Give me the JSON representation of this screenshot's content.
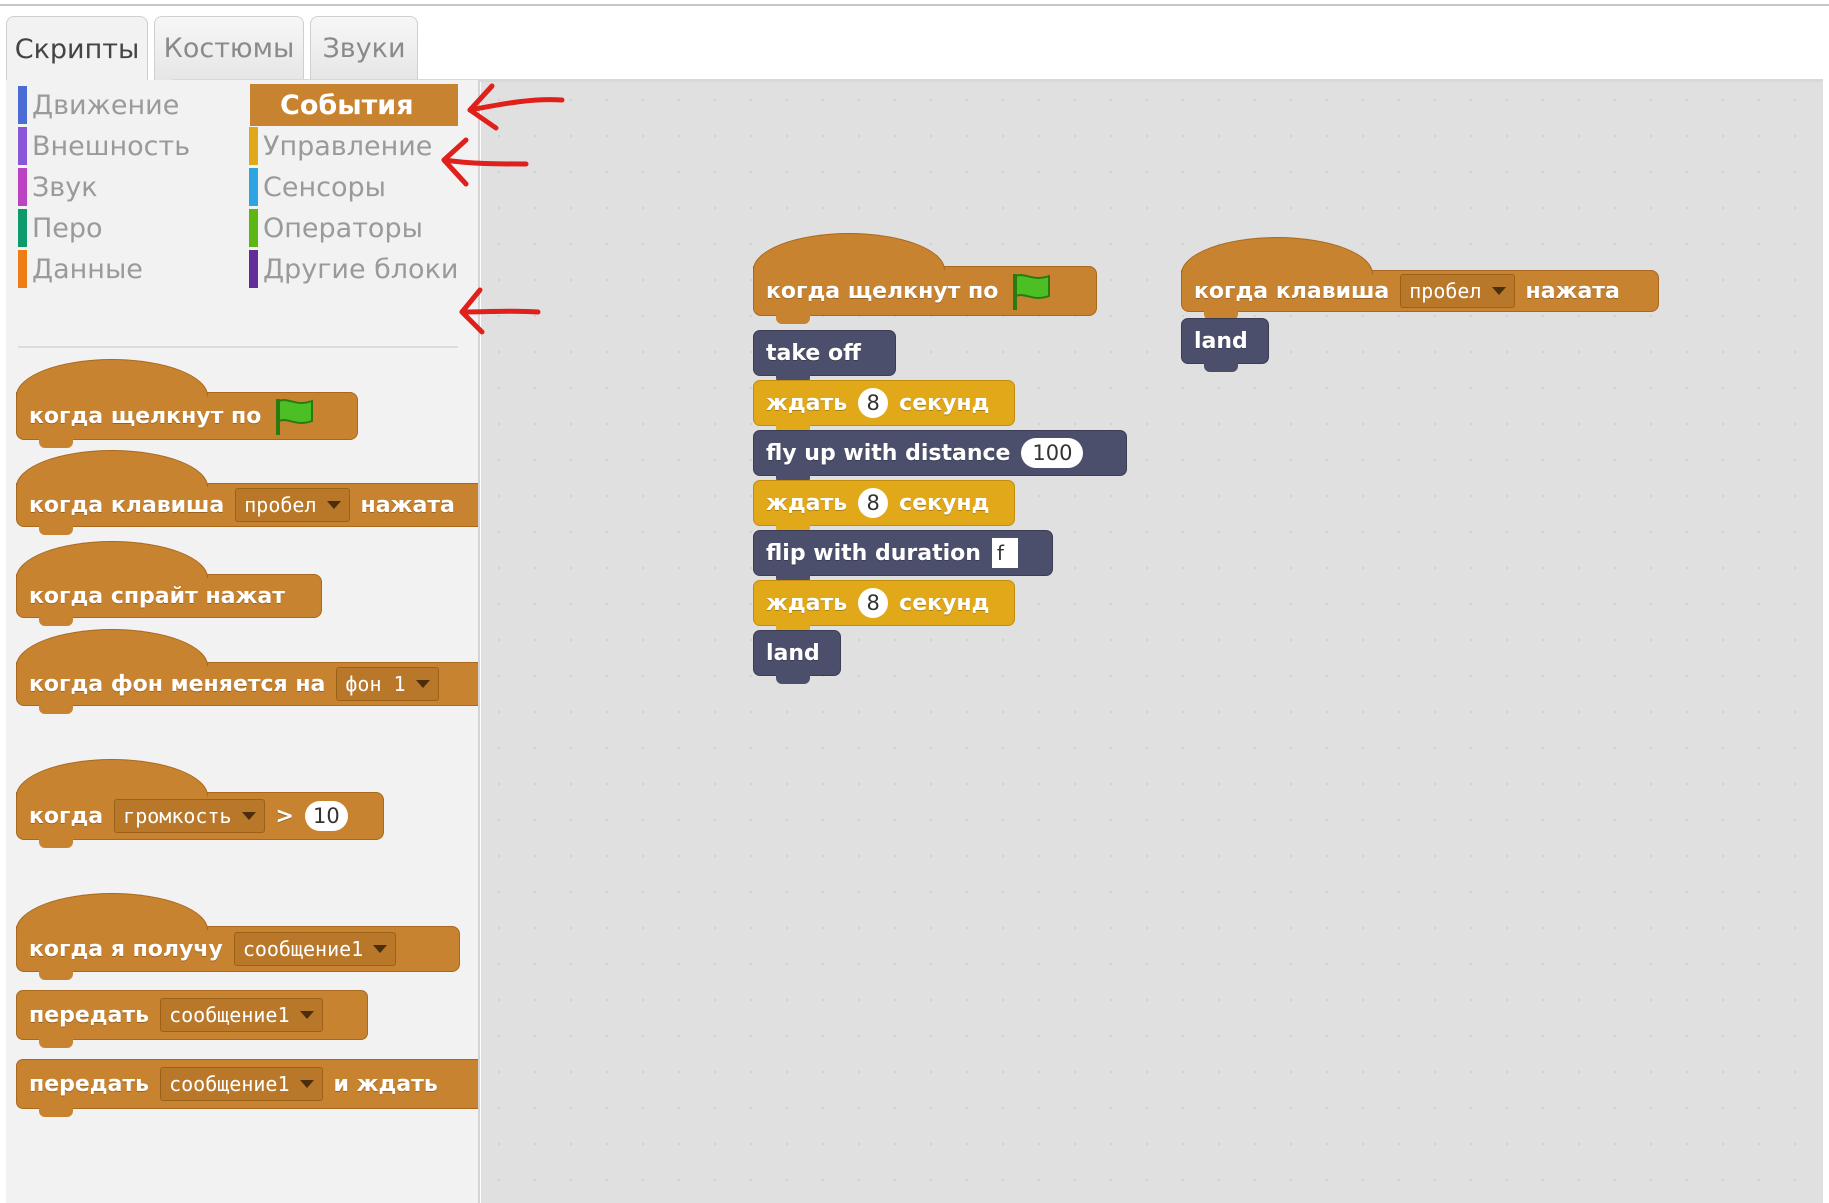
{
  "tabs": [
    "Скрипты",
    "Костюмы",
    "Звуки"
  ],
  "categories": {
    "left": [
      {
        "label": "Движение",
        "color": "#4a6cd4"
      },
      {
        "label": "Внешность",
        "color": "#8a55d7"
      },
      {
        "label": "Звук",
        "color": "#bb42c3"
      },
      {
        "label": "Перо",
        "color": "#0e9a6c"
      },
      {
        "label": "Данные",
        "color": "#ee7d16"
      }
    ],
    "right": [
      {
        "label": "События",
        "color": "#c88330",
        "selected": true
      },
      {
        "label": "Управление",
        "color": "#e1a91a"
      },
      {
        "label": "Сенсоры",
        "color": "#2ca5e2"
      },
      {
        "label": "Операторы",
        "color": "#5cb712"
      },
      {
        "label": "Другие блоки",
        "color": "#632d99"
      }
    ]
  },
  "palette_blocks": {
    "flag_hat": {
      "text": "когда щелкнут по"
    },
    "key_hat": {
      "prefix": "когда клавиша",
      "key": "пробел",
      "suffix": "нажата"
    },
    "sprite_hat": {
      "text": "когда спрайт нажат"
    },
    "backdrop_hat": {
      "prefix": "когда фон меняется на",
      "value": "фон 1"
    },
    "sensor_hat": {
      "prefix": "когда",
      "sensor": "громкость",
      "op": ">",
      "value": "10"
    },
    "receive_hat": {
      "prefix": "когда я получу",
      "message": "сообщение1"
    },
    "broadcast": {
      "prefix": "передать",
      "message": "сообщение1"
    },
    "broadcast_wait": {
      "prefix": "передать",
      "message": "сообщение1",
      "suffix": "и ждать"
    }
  },
  "script1": {
    "hat": "когда щелкнут по",
    "take_off": "take off",
    "wait_label": "ждать",
    "wait_unit": "секунд",
    "wait1": "8",
    "fly_up": "fly up with distance",
    "fly_value": "100",
    "wait2": "8",
    "flip": "flip with duration",
    "flip_value": "f",
    "wait3": "8",
    "land": "land"
  },
  "script2": {
    "prefix": "когда клавиша",
    "key": "пробел",
    "suffix": "нажата",
    "land": "land"
  },
  "colors": {
    "events": "#c88330",
    "control": "#e1a91a",
    "more_blocks": "#4c4f6b",
    "annotation": "#e0201b"
  }
}
